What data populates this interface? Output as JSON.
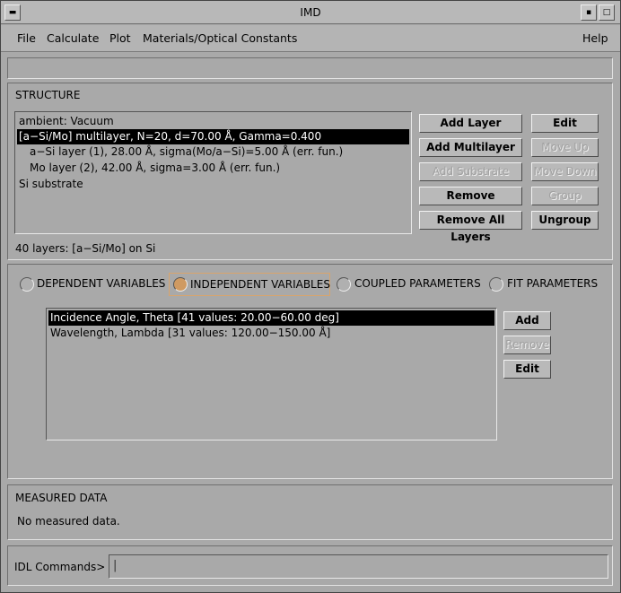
{
  "window": {
    "title": "IMD"
  },
  "menu": {
    "file": "File",
    "calculate": "Calculate",
    "plot": "Plot",
    "materials": "Materials/Optical Constants",
    "help": "Help"
  },
  "structure": {
    "title": "STRUCTURE",
    "layers": [
      "ambient: Vacuum",
      "[a−Si/Mo] multilayer, N=20, d=70.00 Å, Gamma=0.400",
      "a−Si layer (1), 28.00 Å, sigma(Mo/a−Si)=5.00 Å (err. fun.)",
      "Mo layer (2), 42.00 Å, sigma=3.00 Å (err. fun.)",
      "Si substrate"
    ],
    "selected_index": 1,
    "summary": "40 layers: [a−Si/Mo] on Si",
    "buttons": {
      "add_layer": "Add Layer",
      "edit": "Edit",
      "add_multilayer": "Add Multilayer",
      "move_up": "Move Up",
      "add_substrate": "Add Substrate",
      "move_down": "Move Down",
      "remove": "Remove",
      "group": "Group",
      "remove_all": "Remove All Layers",
      "ungroup": "Ungroup"
    }
  },
  "variables": {
    "radios": {
      "dependent": "DEPENDENT VARIABLES",
      "independent": "INDEPENDENT VARIABLES",
      "coupled": "COUPLED PARAMETERS",
      "fit": "FIT PARAMETERS"
    },
    "selected_radio": "independent",
    "items": [
      "Incidence Angle, Theta [41 values: 20.00−60.00 deg]",
      "Wavelength, Lambda [31 values: 120.00−150.00 Å]"
    ],
    "buttons": {
      "add": "Add",
      "remove": "Remove",
      "edit": "Edit"
    }
  },
  "measured": {
    "title": "MEASURED DATA",
    "status": "No measured data."
  },
  "idl": {
    "label": "IDL Commands>",
    "value": ""
  },
  "colors": {
    "background": "#a9a9a9",
    "selection": "#000000",
    "radio_on": "#cf9a62",
    "focus_border": "#d9a46c"
  }
}
